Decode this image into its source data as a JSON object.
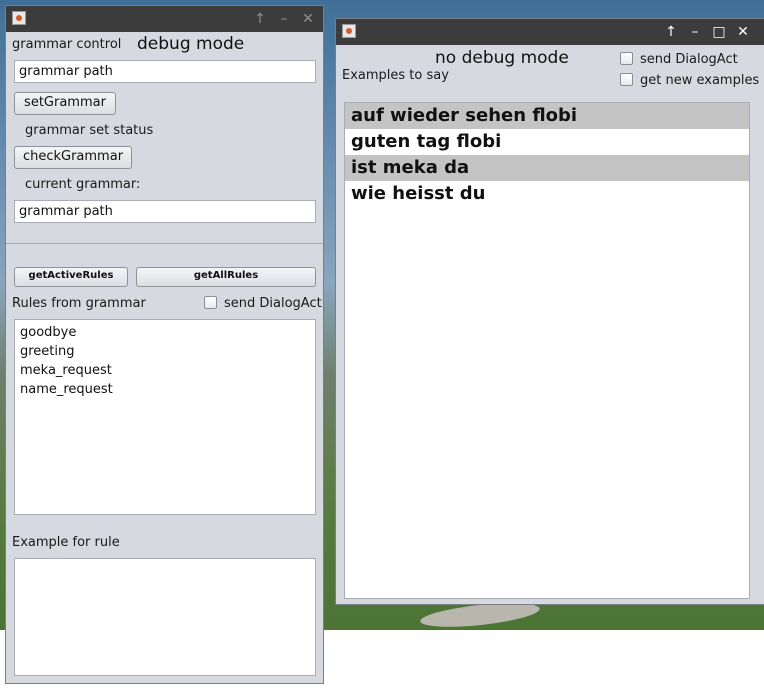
{
  "left_window": {
    "heading_label": "grammar control",
    "mode_title": "debug mode",
    "grammar_path_input": "grammar path",
    "set_grammar_button": "setGrammar",
    "grammar_set_status": "grammar set status",
    "check_grammar_button": "checkGrammar",
    "current_grammar_label": "current grammar:",
    "current_grammar_input": "grammar path",
    "get_active_rules_button": "getActiveRules",
    "get_all_rules_button": "getAllRules",
    "rules_label": "Rules from grammar",
    "send_dialogact_label": "send DialogAct",
    "rules": [
      "goodbye",
      "greeting",
      "meka_request",
      "name_request"
    ],
    "example_label": "Example for rule"
  },
  "right_window": {
    "mode_title": "no debug mode",
    "examples_label": "Examples to say",
    "send_dialogact_label": "send DialogAct",
    "get_new_examples_label": "get new examples",
    "examples": [
      "auf wieder sehen flobi",
      "guten tag flobi",
      "ist meka da",
      "wie heisst du"
    ]
  },
  "titlebar_icons": {
    "maximize": "↑",
    "minimize": "–",
    "restore": "□",
    "close": "✕"
  }
}
